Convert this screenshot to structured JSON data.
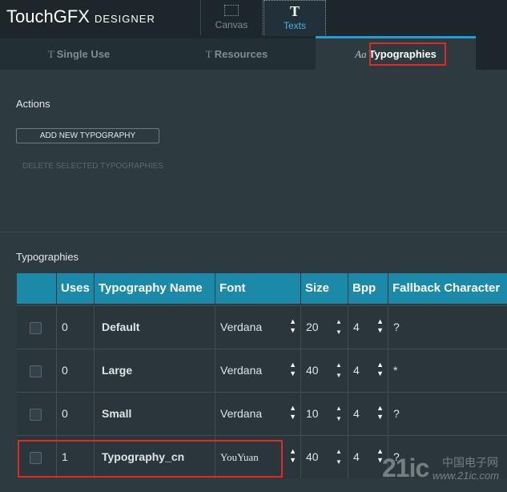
{
  "app": {
    "logo": "TouchGFX",
    "logo_sub": "DESIGNER"
  },
  "modes": [
    {
      "label": "Canvas",
      "icon": "canvas-icon"
    },
    {
      "label": "Texts",
      "icon": "text-icon",
      "glyph": "T"
    }
  ],
  "tabs": [
    {
      "label": "Single Use",
      "glyph": "T",
      "icon": "text-icon"
    },
    {
      "label": "Resources",
      "glyph": "T",
      "icon": "resources-icon"
    },
    {
      "label": "Typographies",
      "glyph": "Aa",
      "icon": "typography-icon"
    }
  ],
  "actions": {
    "title": "Actions",
    "add_label": "ADD NEW TYPOGRAPHY",
    "delete_label": "DELETE SELECTED TYPOGRAPHIES"
  },
  "typographies": {
    "title": "Typographies",
    "columns": [
      "Uses",
      "Typography Name",
      "Font",
      "Size",
      "Bpp",
      "Fallback Character"
    ],
    "rows": [
      {
        "uses": "0",
        "name": "Default",
        "font": "Verdana",
        "size": "20",
        "bpp": "4",
        "fallback": "?"
      },
      {
        "uses": "0",
        "name": "Large",
        "font": "Verdana",
        "size": "40",
        "bpp": "4",
        "fallback": "*"
      },
      {
        "uses": "0",
        "name": "Small",
        "font": "Verdana",
        "size": "10",
        "bpp": "4",
        "fallback": "?"
      },
      {
        "uses": "1",
        "name": "Typography_cn",
        "font": "YouYuan",
        "size": "40",
        "bpp": "4",
        "fallback": "?"
      }
    ]
  },
  "watermark": {
    "brand": "21ic",
    "cn": "中国电子网",
    "url": "www.21ic.com"
  },
  "colors": {
    "accent": "#1a9fdb",
    "header": "#1a8aa8",
    "highlight": "#e02a2a"
  }
}
